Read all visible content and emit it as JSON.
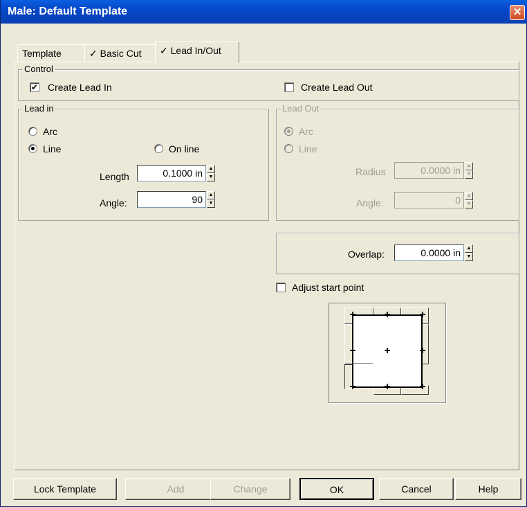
{
  "window": {
    "title": "Male: Default Template",
    "close_glyph": "✕"
  },
  "tabs": [
    {
      "label": "Template"
    },
    {
      "label": "✓ Basic Cut"
    },
    {
      "label": "✓ Lead In/Out"
    }
  ],
  "control": {
    "legend": "Control",
    "create_lead_in": {
      "label": "Create Lead In",
      "checked": true
    },
    "create_lead_out": {
      "label": "Create Lead Out",
      "checked": false
    }
  },
  "lead_in": {
    "legend": "Lead in",
    "arc_label": "Arc",
    "line_label": "Line",
    "on_line_label": "On line",
    "length_label": "Length",
    "length_value": "0.1000 in",
    "angle_label": "Angle:",
    "angle_value": "90",
    "selected": "line"
  },
  "lead_out": {
    "legend": "Lead Out",
    "arc_label": "Arc",
    "line_label": "Line",
    "radius_label": "Radius",
    "radius_value": "0.0000 in",
    "angle_label": "Angle:",
    "angle_value": "0",
    "selected": "arc"
  },
  "overlap": {
    "label": "Overlap:",
    "value": "0.0000 in"
  },
  "adjust_start": {
    "label": "Adjust start point",
    "checked": false
  },
  "buttons": {
    "lock_template": "Lock Template",
    "add": "Add",
    "change": "Change",
    "ok": "OK",
    "cancel": "Cancel",
    "help": "Help"
  },
  "glyphs": {
    "check": "✔",
    "up": "▲",
    "down": "▼",
    "plus": "+"
  }
}
